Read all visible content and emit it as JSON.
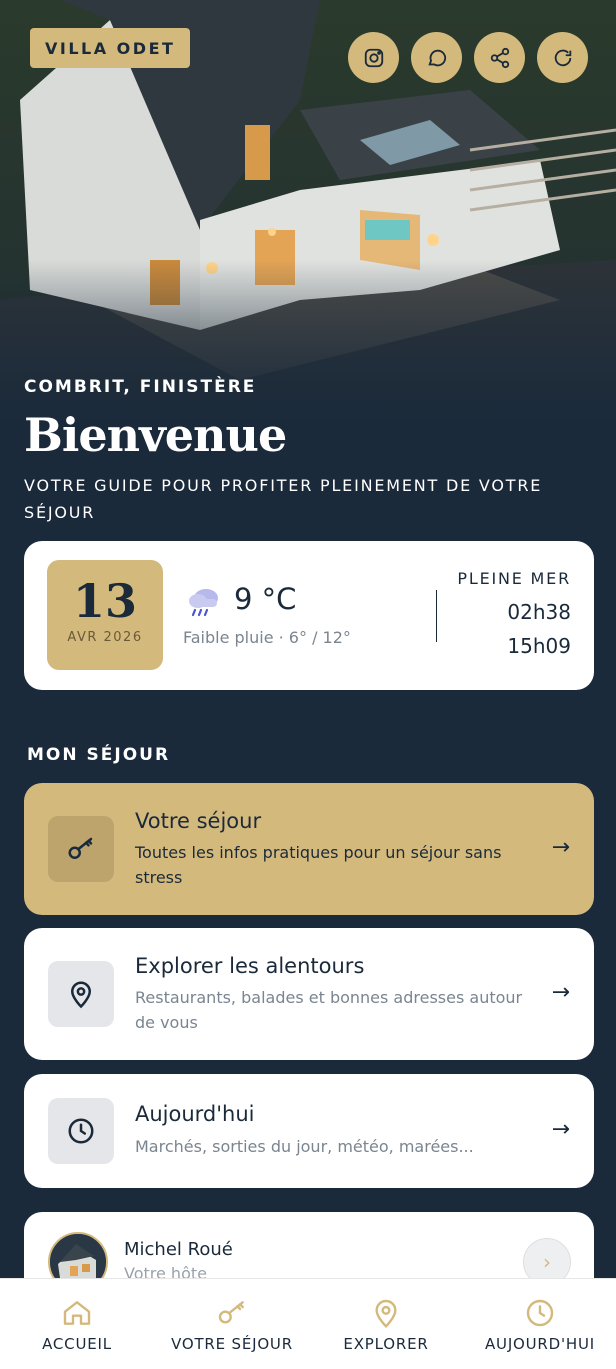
{
  "hero": {
    "brand": "VILLA ODET",
    "location": "COMBRIT, FINISTÈRE",
    "title": "Bienvenue",
    "subtitle": "VOTRE GUIDE POUR PROFITER PLEINEMENT DE VOTRE SÉJOUR",
    "actions": [
      "instagram-icon",
      "chat-icon",
      "share-icon",
      "refresh-icon"
    ]
  },
  "info": {
    "day": "13",
    "month_year": "AVR 2026",
    "weather_icon": "rain-cloud-icon",
    "temperature": "9 °C",
    "weather_desc": "Faible pluie · 6° / 12°",
    "tide_label": "PLEINE MER",
    "tide_times": [
      "02h38",
      "15h09"
    ]
  },
  "section": {
    "title": "MON SÉJOUR"
  },
  "cards": [
    {
      "icon": "key-icon",
      "title": "Votre séjour",
      "desc": "Toutes les infos pratiques pour un séjour sans stress",
      "arrow": "→"
    },
    {
      "icon": "map-pin-icon",
      "title": "Explorer les alentours",
      "desc": "Restaurants, balades et bonnes adresses autour de vous",
      "arrow": "→"
    },
    {
      "icon": "clock-icon",
      "title": "Aujourd'hui",
      "desc": "Marchés, sorties du jour, météo, marées...",
      "arrow": "→"
    }
  ],
  "host": {
    "name": "Michel Roué",
    "role": "Votre hôte",
    "chevron": "›"
  },
  "nav": [
    {
      "icon": "home-icon",
      "label": "ACCUEIL"
    },
    {
      "icon": "key-icon",
      "label": "VOTRE SÉJOUR"
    },
    {
      "icon": "map-pin-icon",
      "label": "EXPLORER"
    },
    {
      "icon": "clock-icon",
      "label": "AUJOURD'HUI"
    }
  ],
  "colors": {
    "navy": "#1a2a3b",
    "gold": "#d4b97c",
    "white": "#ffffff",
    "muted": "#7a8590"
  }
}
